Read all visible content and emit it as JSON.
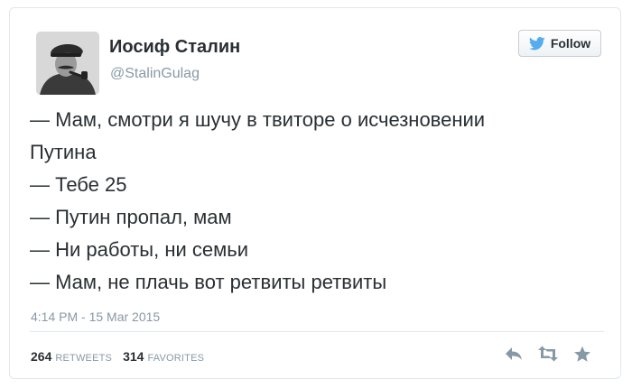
{
  "tweet": {
    "display_name": "Иосиф Сталин",
    "handle": "@StalinGulag",
    "follow_label": "Follow",
    "lines": [
      "— Мам, смотри я шучу в твиторе о исчезновении",
      "Путина",
      "— Тебе 25",
      "— Путин пропал, мам",
      "— Ни работы, ни семьи",
      "— Мам, не плачь вот ретвиты ретвиты"
    ],
    "timestamp": "4:14 PM - 15 Mar 2015",
    "retweets_count": "264",
    "retweets_label": "RETWEETS",
    "favorites_count": "314",
    "favorites_label": "FAVORITES"
  },
  "icons": {
    "follow": "twitter-bird-icon",
    "reply": "reply-icon",
    "retweet": "retweet-icon",
    "favorite": "star-icon"
  },
  "colors": {
    "bird": "#55acee",
    "text": "#292f33",
    "muted": "#8899a6",
    "action_icon": "#8899a6"
  }
}
